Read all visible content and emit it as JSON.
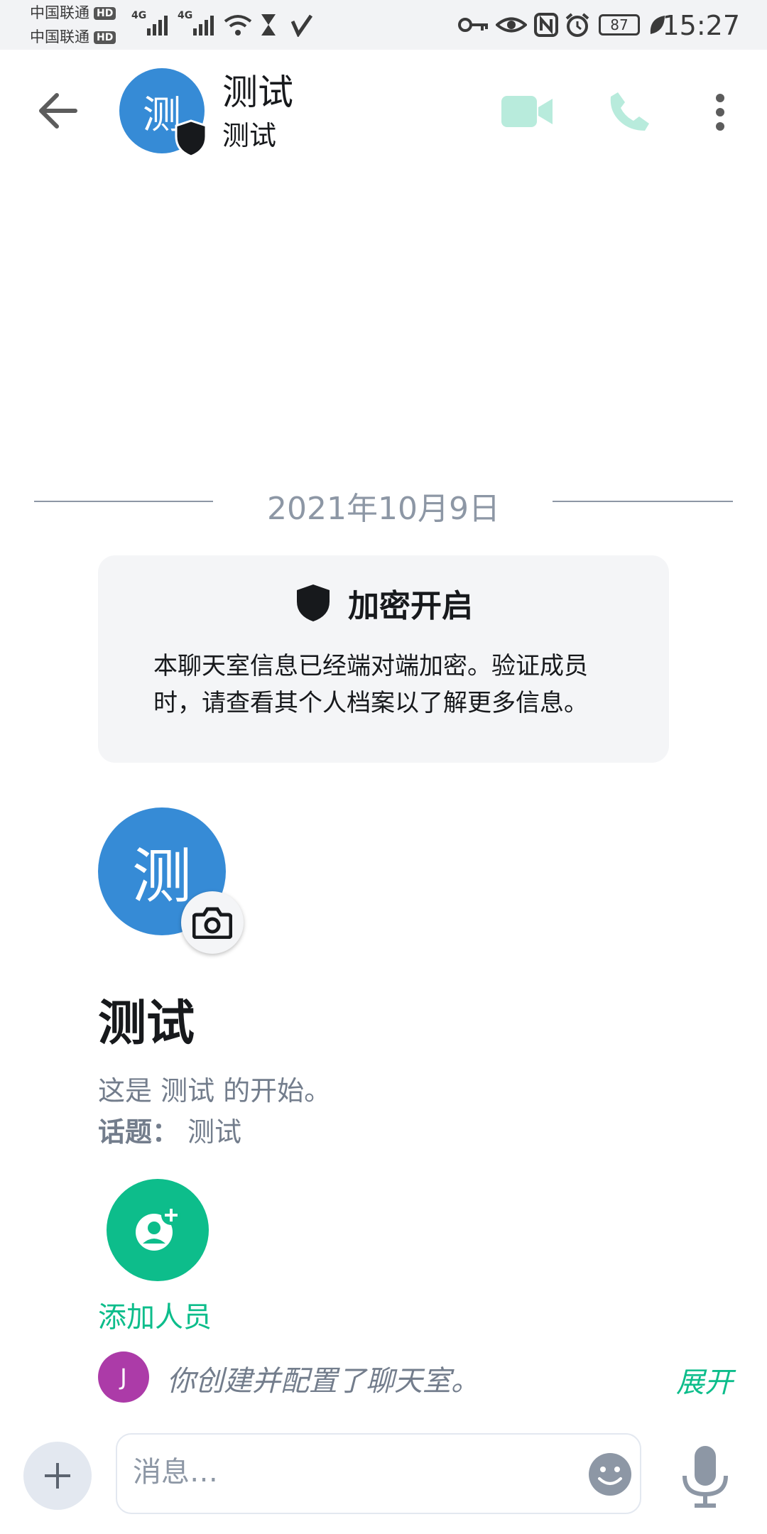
{
  "status_bar": {
    "carrier_1": "中国联通",
    "carrier_2": "中国联通",
    "hd_badge": "HD",
    "network_1": "4G",
    "network_2": "4G",
    "battery": "87",
    "time": "15:27"
  },
  "header": {
    "avatar_letter": "测",
    "room_name": "测试",
    "room_subtitle": "测试",
    "icons": [
      "back-arrow-icon",
      "video-call-icon",
      "voice-call-icon",
      "more-options-icon"
    ]
  },
  "timeline": {
    "date_separator": "2021年10月9日",
    "encryption": {
      "title": "加密开启",
      "body": "本聊天室信息已经端对端加密。验证成员时，请查看其个人档案以了解更多信息。"
    },
    "room_intro": {
      "avatar_letter": "测",
      "title": "测试",
      "intro_text": "这是 测试 的开始。",
      "topic_label": "话题：",
      "topic_value": "测试"
    },
    "add_people_label": "添加人员",
    "event": {
      "avatar_letter": "J",
      "text": "你创建并配置了聊天室。",
      "expand_label": "展开"
    }
  },
  "composer": {
    "placeholder": "消息…"
  },
  "colors": {
    "accent": "#0dbd8b",
    "room_avatar": "#368bd6",
    "user_avatar": "#ac3ba8",
    "secondary_text": "#737d8c"
  }
}
